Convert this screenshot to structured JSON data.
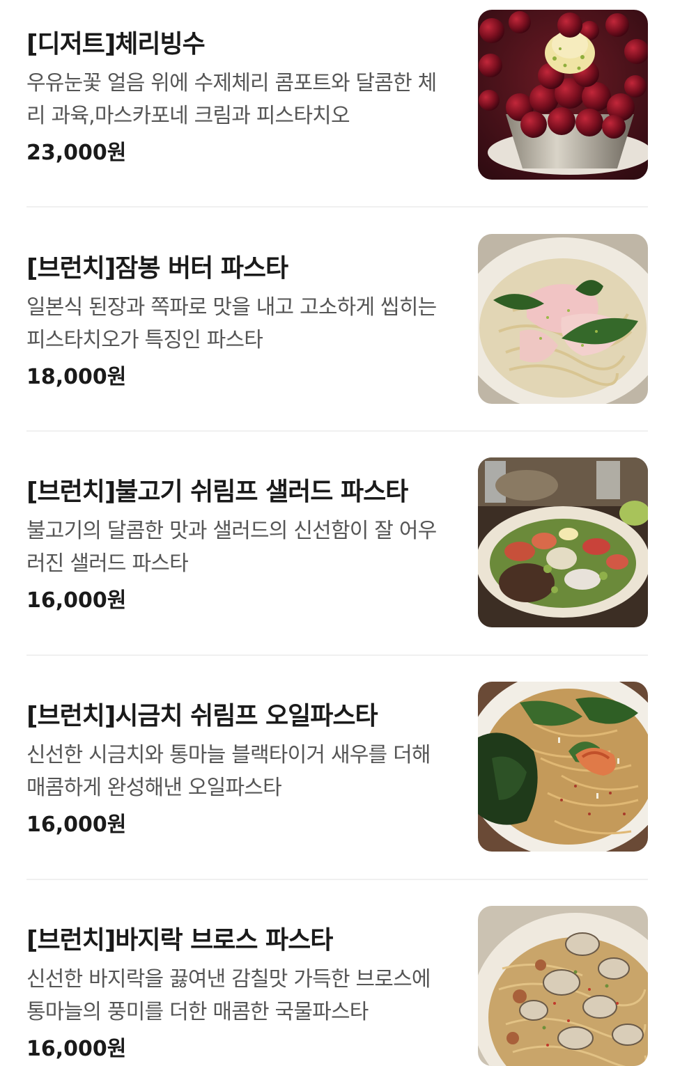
{
  "menu": {
    "items": [
      {
        "title": "[디저트]체리빙수",
        "description": "우유눈꽃 얼음 위에 수제체리 콤포트와 달콤한 체리 과육,마스카포네 크림과 피스타치오",
        "price": "23,000원",
        "image": "cherry-bingsu-photo"
      },
      {
        "title": "[브런치]잠봉 버터 파스타",
        "description": "일본식 된장과 쪽파로 맛을 내고 고소하게 씹히는 피스타치오가 특징인 파스타",
        "price": "18,000원",
        "image": "jambon-butter-pasta-photo"
      },
      {
        "title": "[브런치]불고기 쉬림프 샐러드 파스타",
        "description": "불고기의 달콤한 맛과 샐러드의 신선함이 잘 어우러진 샐러드 파스타",
        "price": "16,000원",
        "image": "bulgogi-shrimp-salad-pasta-photo"
      },
      {
        "title": "[브런치]시금치 쉬림프 오일파스타",
        "description": "신선한 시금치와 통마늘 블랙타이거 새우를 더해 매콤하게 완성해낸 오일파스타",
        "price": "16,000원",
        "image": "spinach-shrimp-oil-pasta-photo"
      },
      {
        "title": "[브런치]바지락 브로스 파스타",
        "description": "신선한 바지락을 끓여낸 감칠맛 가득한 브로스에 통마늘의 풍미를 더한 매콤한 국물파스타",
        "price": "16,000원",
        "image": "clam-broth-pasta-photo"
      }
    ]
  },
  "colors": {
    "title": "#1a1a1a",
    "description": "#555555",
    "divider": "#f0f0f0"
  }
}
